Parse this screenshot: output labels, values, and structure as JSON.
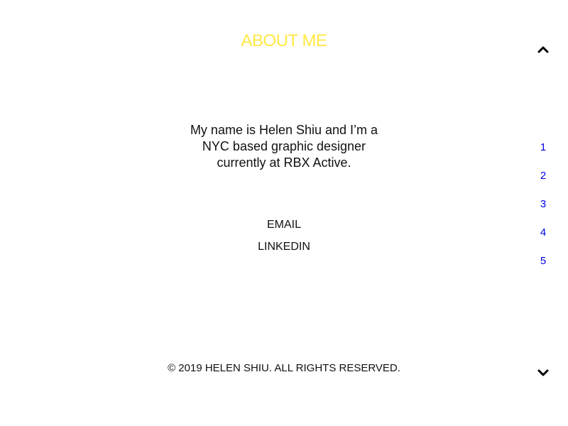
{
  "theme": {
    "accent": "#ffe844",
    "link": "#0000ee",
    "text": "#111111",
    "background": "#ffffff"
  },
  "header": {
    "title": "ABOUT ME"
  },
  "bio": {
    "lines": [
      "My name is Helen Shiu and I’m a",
      "NYC based graphic designer",
      "currently at RBX Active."
    ]
  },
  "contact": {
    "email_label": "EMAIL",
    "linkedin_label": "LINKEDIN"
  },
  "footer": {
    "copyright": "© 2019 HELEN SHIU. ALL RIGHTS RESERVED."
  },
  "side_nav": {
    "up_icon": "chevron-up-icon",
    "down_icon": "chevron-down-icon",
    "pages": [
      "1",
      "2",
      "3",
      "4",
      "5"
    ]
  }
}
